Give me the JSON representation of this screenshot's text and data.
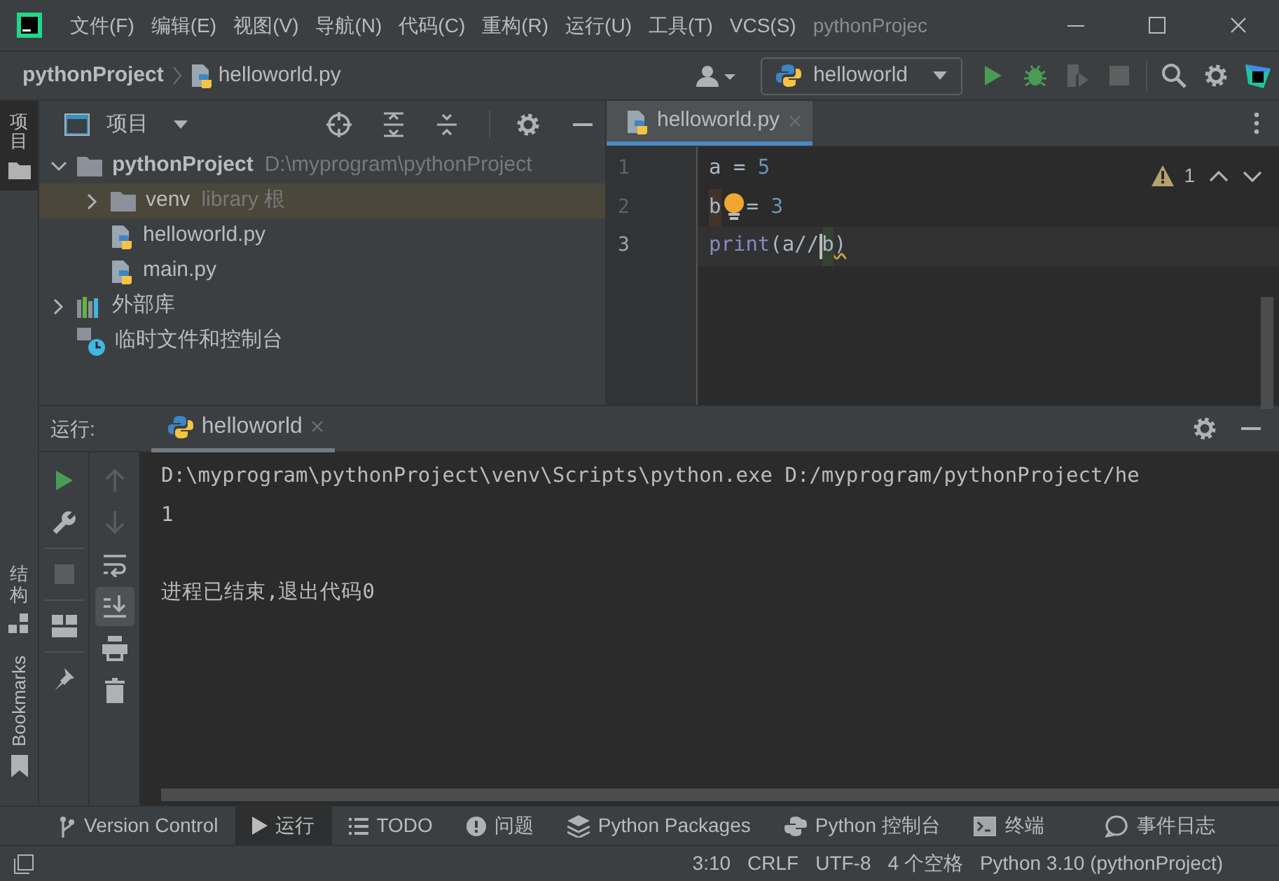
{
  "window": {
    "title": "pythonProjec",
    "menu": [
      "文件(F)",
      "编辑(E)",
      "视图(V)",
      "导航(N)",
      "代码(C)",
      "重构(R)",
      "运行(U)",
      "工具(T)",
      "VCS(S)"
    ]
  },
  "navbar": {
    "breadcrumb": [
      "pythonProject",
      "helloworld.py"
    ],
    "run_config": "helloworld"
  },
  "left_strip": [
    {
      "label": "项目",
      "kind": "cjk",
      "selected": true
    },
    {
      "label": "结构",
      "kind": "cjk",
      "selected": false
    },
    {
      "label": "Bookmarks",
      "kind": "latin",
      "selected": false
    }
  ],
  "project_panel": {
    "title": "项目",
    "tree": [
      {
        "name": "pythonProject",
        "hint": "D:\\myprogram\\pythonProject",
        "kind": "folder",
        "expanded": true,
        "selected": false,
        "children": [
          {
            "name": "venv",
            "hint": "library 根",
            "kind": "folder",
            "expanded": false,
            "selected": true
          },
          {
            "name": "helloworld.py",
            "kind": "python",
            "selected": false
          },
          {
            "name": "main.py",
            "kind": "python",
            "selected": false
          }
        ]
      },
      {
        "name": "外部库",
        "kind": "library",
        "expanded": false,
        "selected": false
      },
      {
        "name": "临时文件和控制台",
        "kind": "scratch",
        "selected": false
      }
    ]
  },
  "editor": {
    "tabs": [
      {
        "label": "helloworld.py",
        "selected": true
      }
    ],
    "warnings": "1",
    "lines": [
      {
        "number": "1",
        "current": false,
        "tokens": [
          {
            "text": "a = ",
            "kind": "plain"
          },
          {
            "text": "5",
            "kind": "number"
          }
        ]
      },
      {
        "number": "2",
        "current": false,
        "tokens": [
          {
            "text": "b",
            "kind": "unused"
          },
          {
            "kind": "bulb"
          },
          {
            "text": "= ",
            "kind": "plain"
          },
          {
            "text": "3",
            "kind": "number"
          }
        ]
      },
      {
        "number": "3",
        "current": true,
        "tokens": [
          {
            "text": "print",
            "kind": "builtin"
          },
          {
            "text": "(a//",
            "kind": "plain"
          },
          {
            "kind": "caret"
          },
          {
            "text": "b",
            "kind": "match"
          },
          {
            "text": ")",
            "kind": "warning"
          }
        ]
      }
    ]
  },
  "run_panel": {
    "label": "运行:",
    "tabs": [
      {
        "label": "helloworld",
        "selected": true
      }
    ],
    "toolbar_left": [
      {
        "kind": "run",
        "disabled": false
      },
      {
        "kind": "wrench",
        "disabled": false
      },
      {
        "kind": "stop",
        "disabled": true
      },
      {
        "kind": "layout",
        "disabled": false
      },
      {
        "kind": "pin",
        "disabled": false
      }
    ],
    "toolbar_right": [
      {
        "kind": "up",
        "disabled": true,
        "on": false
      },
      {
        "kind": "down",
        "disabled": true,
        "on": false
      },
      {
        "kind": "wrap",
        "disabled": false,
        "on": false
      },
      {
        "kind": "scroll-end",
        "disabled": false,
        "on": true
      },
      {
        "kind": "print",
        "disabled": false,
        "on": false
      },
      {
        "kind": "trash",
        "disabled": false,
        "on": false
      }
    ],
    "output": [
      {
        "text": "D:\\myprogram\\pythonProject\\venv\\Scripts\\python.exe D:/myprogram/pythonProject/he",
        "kind": "command"
      },
      {
        "text": "1",
        "kind": "stdout"
      },
      {
        "text": "进程已结束,退出代码0",
        "kind": "exit"
      }
    ]
  },
  "tool_tabs": [
    {
      "label": "Version Control",
      "kind": "branch",
      "selected": false
    },
    {
      "label": "运行",
      "kind": "run",
      "selected": true
    },
    {
      "label": "TODO",
      "kind": "list",
      "selected": false
    },
    {
      "label": "问题",
      "kind": "problem",
      "selected": false
    },
    {
      "label": "Python Packages",
      "kind": "layers",
      "selected": false
    },
    {
      "label": "Python 控制台",
      "kind": "python",
      "selected": false
    },
    {
      "label": "终端",
      "kind": "terminal",
      "selected": false
    },
    {
      "label": "事件日志",
      "kind": "bubble",
      "selected": false
    }
  ],
  "status_bar": [
    "3:10",
    "CRLF",
    "UTF-8",
    "4 个空格",
    "Python 3.10 (pythonProject)"
  ]
}
